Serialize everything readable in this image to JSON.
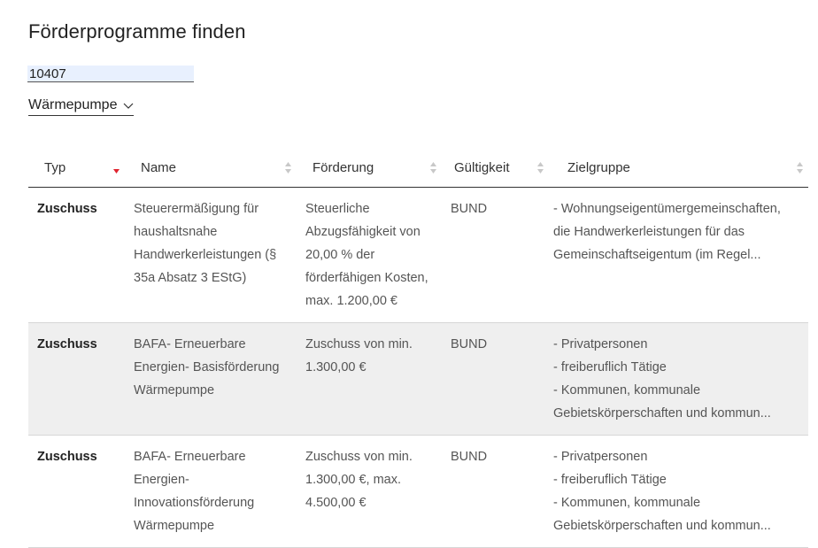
{
  "page": {
    "title": "Förderprogramme finden"
  },
  "search": {
    "zip_value": "10407"
  },
  "filter": {
    "selected": "Wärmepumpe"
  },
  "colors": {
    "accent_sort": "#e0242f",
    "row_shaded": "#efefef"
  },
  "table": {
    "headers": {
      "typ": "Typ",
      "name": "Name",
      "foerderung": "Förderung",
      "gueltigkeit": "Gültigkeit",
      "zielgruppe": "Zielgruppe"
    },
    "rows": [
      {
        "typ": "Zuschuss",
        "name": "Steuerermäßigung für haushaltsnahe Handwerkerleistungen (§ 35a Absatz 3 EStG)",
        "foerderung": "Steuerliche Abzugsfähigkeit von 20,00 % der förderfähigen Kosten, max. 1.200,00 €",
        "gueltigkeit": "BUND",
        "zielgruppe": [
          "- Wohnungseigentümergemeinschaften,",
          "die Handwerkerleistungen für das",
          "Gemeinschaftseigentum (im Regel..."
        ]
      },
      {
        "typ": "Zuschuss",
        "name": "BAFA- Erneuerbare Energien- Basisförderung Wärmepumpe",
        "foerderung": "Zuschuss von min. 1.300,00 €",
        "gueltigkeit": "BUND",
        "zielgruppe": [
          "- Privatpersonen",
          "- freiberuflich Tätige",
          "- Kommunen, kommunale",
          "Gebietskörperschaften und kommun..."
        ]
      },
      {
        "typ": "Zuschuss",
        "name": "BAFA- Erneuerbare Energien- Innovationsförderung Wärmepumpe",
        "foerderung": "Zuschuss von min. 1.300,00 €, max. 4.500,00 €",
        "gueltigkeit": "BUND",
        "zielgruppe": [
          "- Privatpersonen",
          "- freiberuflich Tätige",
          "- Kommunen, kommunale",
          "Gebietskörperschaften und kommun..."
        ]
      }
    ]
  }
}
